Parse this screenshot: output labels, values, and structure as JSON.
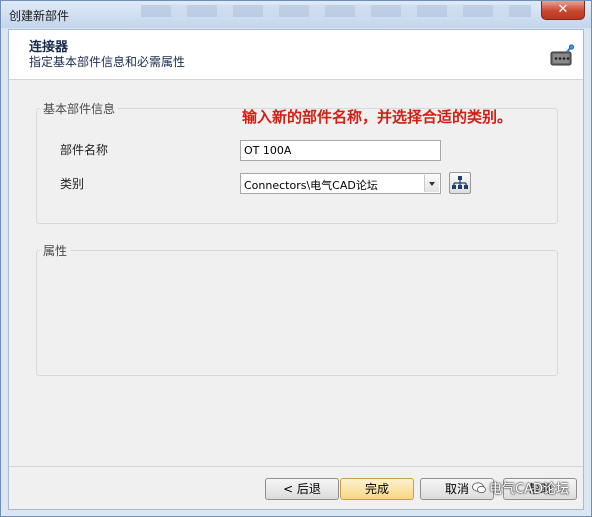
{
  "window": {
    "title": "创建新部件",
    "close_icon": "✕"
  },
  "header": {
    "title": "连接器",
    "subtitle": "指定基本部件信息和必需属性",
    "icon": "connector-icon"
  },
  "basic_group": {
    "legend": "基本部件信息",
    "hint": "输入新的部件名称，并选择合适的类别。",
    "part_name_label": "部件名称",
    "part_name_value": "OT 100A",
    "category_label": "类别",
    "category_value": "Connectors\\电气CAD论坛",
    "tree_button_icon": "hierarchy-icon"
  },
  "props_group": {
    "legend": "属性"
  },
  "footer": {
    "back": "< 后退",
    "finish": "完成",
    "cancel": "取消",
    "help": "帮助"
  },
  "watermark": {
    "text": "电气CAD论坛"
  },
  "colors": {
    "hint": "#d41f14",
    "finish_button": "#f6d781",
    "header_title": "#1a2b4c"
  }
}
